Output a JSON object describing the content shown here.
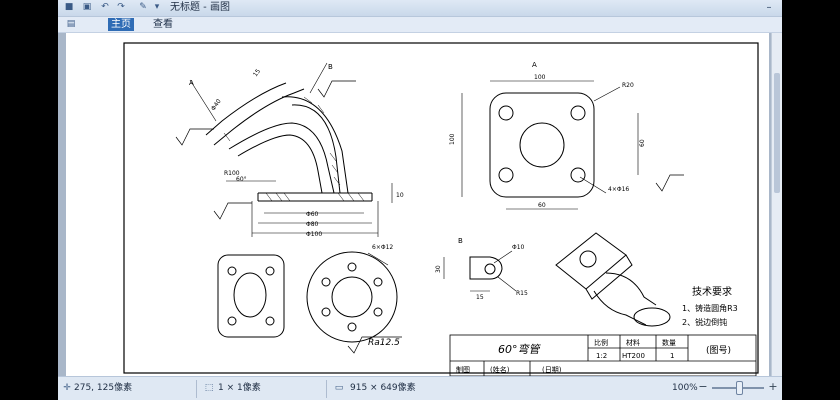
{
  "window": {
    "title": "无标题 - 画图",
    "menu": {
      "home": "主页",
      "view": "查看"
    },
    "controls": {
      "minimize": "–",
      "close": "×"
    }
  },
  "status": {
    "cursor": "275, 125像素",
    "selection": "1 × 1像素",
    "image_size": "915 × 649像素",
    "zoom": "100%"
  },
  "drawing": {
    "labels": {
      "a": "A",
      "b": "B",
      "a_ref": "A",
      "b_ref": "B",
      "d40": "Φ40",
      "d15": "15",
      "r100": "R100",
      "d60deg": "60°",
      "d10": "10",
      "d60": "Φ60",
      "d80": "Φ80",
      "d100": "Φ100",
      "holes6": "6×Φ12",
      "w100": "100",
      "h100": "100",
      "r20": "R20",
      "h60": "60",
      "w60": "60",
      "holes4": "4×Φ16",
      "d10b": "Φ10",
      "d30": "30",
      "r15": "R15",
      "d15b": "15",
      "roughness": "Ra12.5"
    },
    "notes": {
      "title": "技术要求",
      "item1": "1、铸造圆角R3",
      "item2": "2、锐边倒钝"
    },
    "titleblock": {
      "name": "60°弯管",
      "col1": "比例",
      "col2": "材料",
      "col3": "数量",
      "scale": "1:2",
      "material": "HT200",
      "qty": "1",
      "ref": "(图号)",
      "maker": "制图",
      "maker_name": "(姓名)",
      "date": "(日期)"
    }
  }
}
